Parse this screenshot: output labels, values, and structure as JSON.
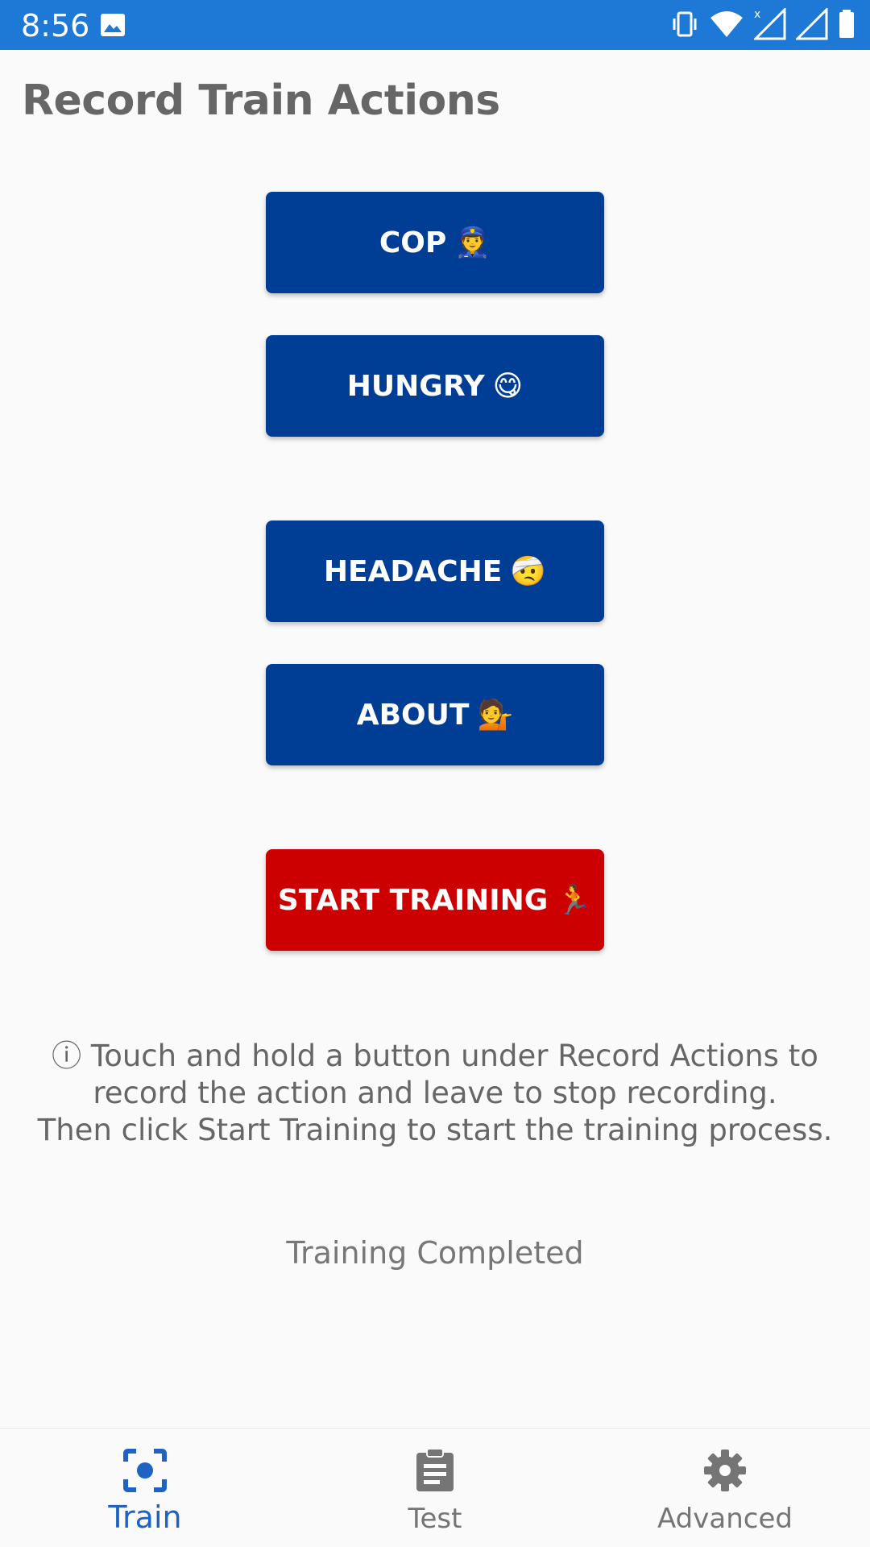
{
  "status_bar": {
    "time": "8:56",
    "bg_color": "#1e78d6",
    "icons": [
      "image-icon",
      "vibrate-icon",
      "wifi-icon",
      "signal-x-icon",
      "signal-icon",
      "battery-icon"
    ]
  },
  "title": "Record Train Actions",
  "buttons": [
    {
      "label": "COP",
      "emoji": "👮",
      "color": "#003d95"
    },
    {
      "label": "HUNGRY",
      "emoji": "😋",
      "color": "#003d95"
    },
    {
      "label": "HEADACHE",
      "emoji": "🤕",
      "color": "#003d95"
    },
    {
      "label": "ABOUT",
      "emoji": "💁",
      "color": "#003d95"
    },
    {
      "label": "START TRAINING",
      "emoji": "🏃",
      "color": "#cc0000"
    }
  ],
  "info": {
    "icon": "ⓘ",
    "line1": "Touch and hold a button under Record Actions to",
    "line2": "record the action and leave to stop recording.",
    "line3": "Then click Start Training to start the training process."
  },
  "training_status": "Training Completed",
  "bottom_nav": [
    {
      "label": "Train",
      "icon": "focus-camera-icon",
      "active": true
    },
    {
      "label": "Test",
      "icon": "clipboard-icon",
      "active": false
    },
    {
      "label": "Advanced",
      "icon": "gear-icon",
      "active": false
    }
  ],
  "colors": {
    "accent": "#1e63c4",
    "primary_button": "#003d95",
    "danger_button": "#cc0000"
  }
}
